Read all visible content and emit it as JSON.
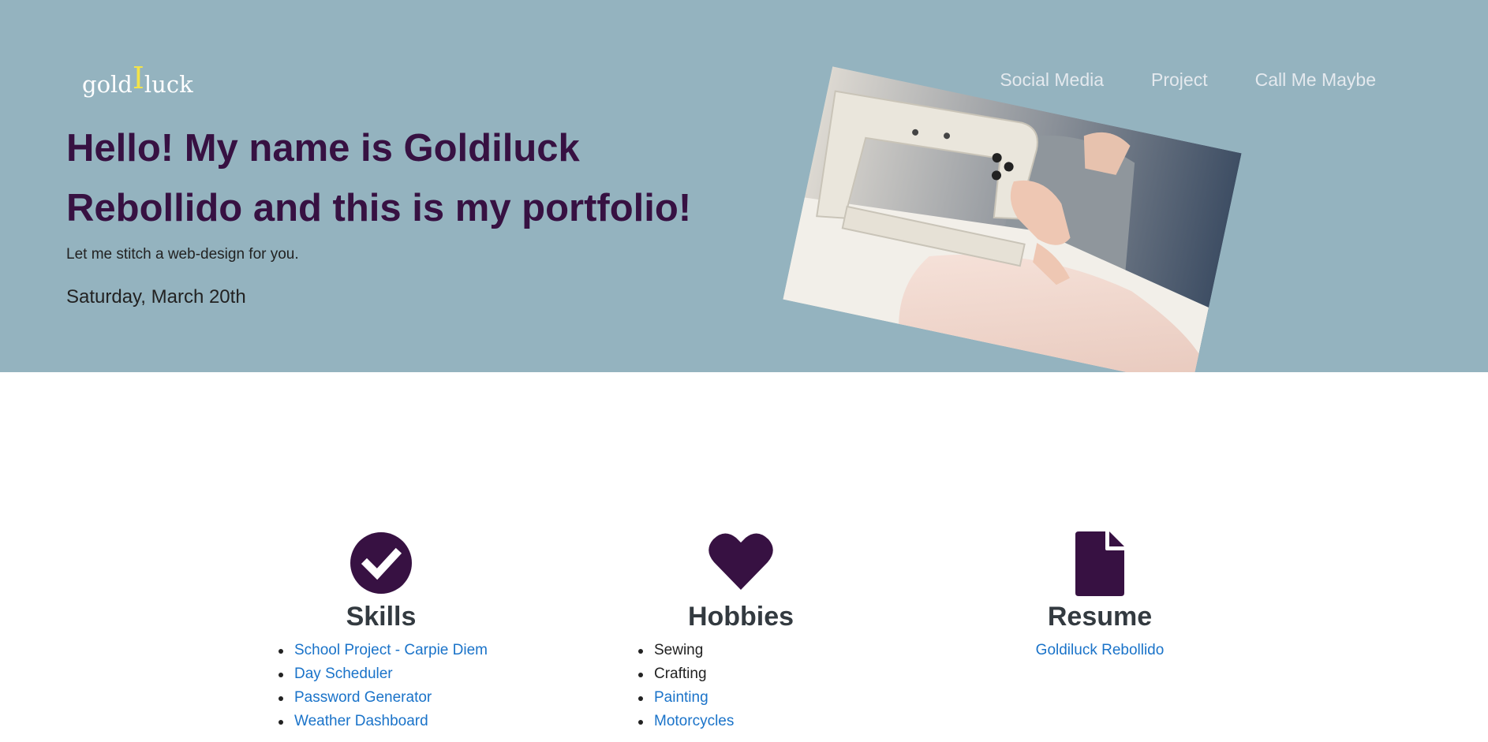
{
  "header": {
    "logo": {
      "left": "gold",
      "middle": "I",
      "right": "luck"
    },
    "nav": [
      {
        "label": "Social Media"
      },
      {
        "label": "Project"
      },
      {
        "label": "Call Me Maybe"
      }
    ]
  },
  "hero": {
    "title": "Hello! My name is Goldiluck Rebollido and this is my portfolio!",
    "tagline": "Let me stitch a web-design for you.",
    "date": "Saturday, March 20th",
    "image_subject": "sewing machine"
  },
  "sections": {
    "skills": {
      "icon": "check-circle-icon",
      "title": "Skills",
      "items": [
        {
          "label": "School Project - Carpie Diem",
          "link": true
        },
        {
          "label": "Day Scheduler",
          "link": true
        },
        {
          "label": "Password Generator",
          "link": true
        },
        {
          "label": "Weather Dashboard",
          "link": true
        }
      ]
    },
    "hobbies": {
      "icon": "heart-icon",
      "title": "Hobbies",
      "items": [
        {
          "label": "Sewing",
          "link": false
        },
        {
          "label": "Crafting",
          "link": false
        },
        {
          "label": "Painting",
          "link": true
        },
        {
          "label": "Motorcycles",
          "link": true
        }
      ]
    },
    "resume": {
      "icon": "document-icon",
      "title": "Resume",
      "link_label": "Goldiluck Rebollido"
    }
  },
  "colors": {
    "hero_bg": "#94b3bf",
    "accent": "#371142",
    "heading": "#333a40",
    "link": "#1a73c9",
    "logo_accent": "#f2e34a"
  }
}
